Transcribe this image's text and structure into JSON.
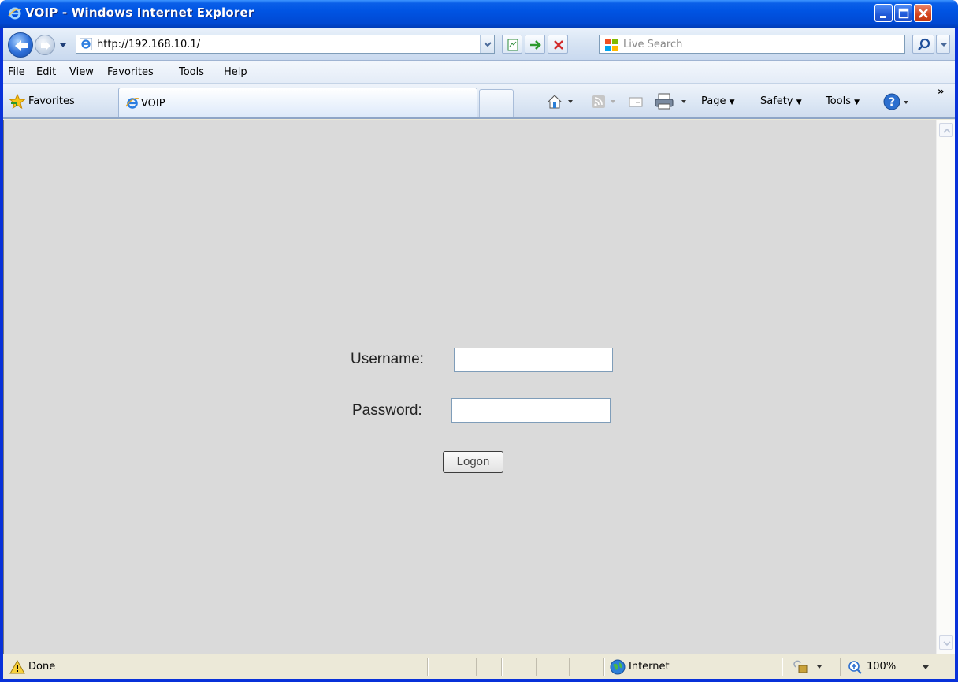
{
  "window": {
    "title": "VOIP - Windows Internet Explorer"
  },
  "address_bar": {
    "url": "http://192.168.10.1/"
  },
  "search": {
    "placeholder": "Live Search"
  },
  "menu": {
    "items": [
      "File",
      "Edit",
      "View",
      "Favorites",
      "Tools",
      "Help"
    ]
  },
  "favorites_bar": {
    "favorites_label": "Favorites",
    "tab_label": "VOIP"
  },
  "command_bar": {
    "page": "Page",
    "safety": "Safety",
    "tools": "Tools"
  },
  "login_form": {
    "username_label": "Username:",
    "username_value": "",
    "password_label": "Password:",
    "password_value": "",
    "logon_button": "Logon"
  },
  "status_bar": {
    "status": "Done",
    "zone": "Internet",
    "zoom": "100%"
  },
  "icons": {
    "ie_logo": "internet-explorer-icon",
    "globe": "globe-icon",
    "warning": "warning-icon"
  }
}
